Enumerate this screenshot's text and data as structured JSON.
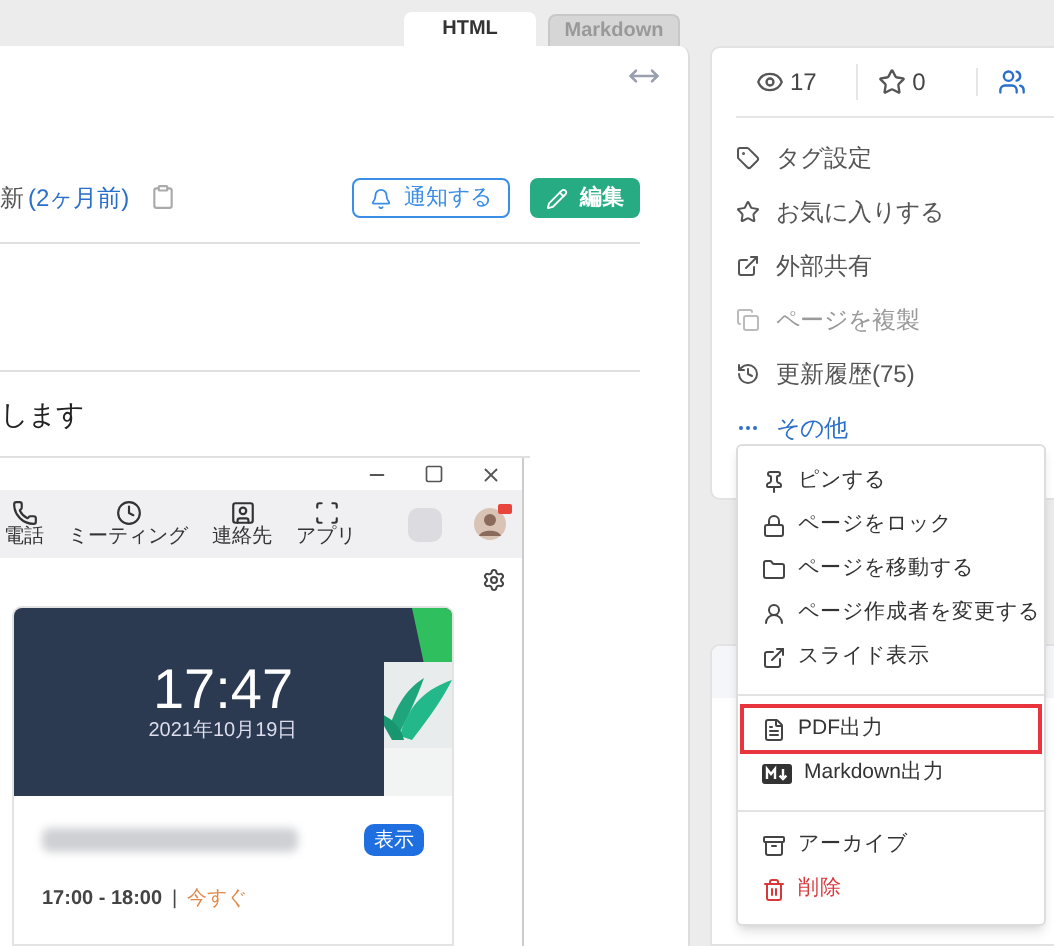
{
  "tabs": [
    {
      "label": "HTML",
      "selected": true
    },
    {
      "label": "Markdown",
      "selected": false
    }
  ],
  "page_header": {
    "updated_text": "新",
    "updated_link": "(2ヶ月前)",
    "buttons": [
      {
        "label": "通知する",
        "kind": "outline"
      },
      {
        "label": "編集",
        "kind": "primary"
      }
    ]
  },
  "body_text": "します",
  "embedded_app": {
    "nav": [
      {
        "label": "電話"
      },
      {
        "label": "ミーティング"
      },
      {
        "label": "連絡先"
      },
      {
        "label": "アプリ"
      }
    ],
    "clock": {
      "time": "17:47",
      "date": "2021年10月19日"
    },
    "event": {
      "button": "表示",
      "time": "17:00 - 18:00",
      "separator": "|",
      "status": "今すぐ"
    }
  },
  "sidebar": {
    "stats": [
      {
        "value": "17"
      },
      {
        "value": "0"
      }
    ],
    "items": [
      {
        "label": "タグ設定",
        "kind": "normal",
        "disabled": false
      },
      {
        "label": "お気に入りする",
        "kind": "normal",
        "disabled": false
      },
      {
        "label": "外部共有",
        "kind": "normal",
        "disabled": false
      },
      {
        "label": "ページを複製",
        "kind": "normal",
        "disabled": true
      },
      {
        "label": "更新履歴(75)",
        "kind": "normal",
        "disabled": false
      },
      {
        "label": "その他",
        "kind": "link",
        "disabled": false
      }
    ]
  },
  "dropdown": {
    "groups": [
      [
        {
          "label": "ピンする",
          "kind": "normal",
          "highlighted": false
        },
        {
          "label": "ページをロック",
          "kind": "normal",
          "highlighted": false
        },
        {
          "label": "ページを移動する",
          "kind": "normal",
          "highlighted": false
        },
        {
          "label": "ページ作成者を変更する",
          "kind": "normal",
          "highlighted": false
        },
        {
          "label": "スライド表示",
          "kind": "normal",
          "highlighted": false
        }
      ],
      [
        {
          "label": "PDF出力",
          "kind": "normal",
          "highlighted": true
        },
        {
          "label": "Markdown出力",
          "kind": "normal",
          "highlighted": false
        }
      ],
      [
        {
          "label": "アーカイブ",
          "kind": "normal",
          "highlighted": false
        },
        {
          "label": "削除",
          "kind": "danger",
          "highlighted": false
        }
      ]
    ]
  }
}
